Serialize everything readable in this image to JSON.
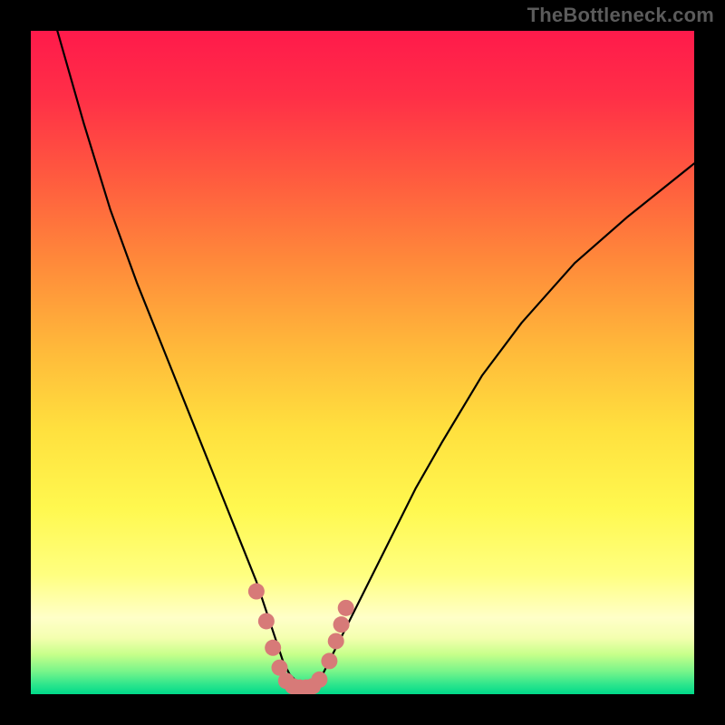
{
  "watermark": "TheBottleneck.com",
  "colors": {
    "black": "#000000",
    "curve": "#000000",
    "dot": "#d77a78",
    "grad_top": "#ff1a4b",
    "grad_mid1": "#ff7a3a",
    "grad_mid2": "#ffd23a",
    "grad_mid3": "#ffff66",
    "grad_pale": "#ffffc0",
    "grad_green1": "#9cff7a",
    "grad_green2": "#30e87a",
    "grad_green3": "#00d98a"
  },
  "chart_data": {
    "type": "line",
    "title": "",
    "xlabel": "",
    "ylabel": "",
    "xlim": [
      0,
      100
    ],
    "ylim": [
      0,
      100
    ],
    "curve": {
      "x": [
        0,
        4,
        8,
        12,
        16,
        20,
        24,
        28,
        30,
        32,
        34,
        35,
        36,
        37,
        38,
        39,
        40,
        41,
        42,
        43,
        44,
        45,
        47,
        50,
        54,
        58,
        62,
        68,
        74,
        82,
        90,
        100
      ],
      "y": [
        118,
        100,
        86,
        73,
        62,
        52,
        42,
        32,
        27,
        22,
        17,
        14,
        11,
        8,
        5,
        3,
        2,
        1,
        1,
        1.5,
        3,
        5,
        9,
        15,
        23,
        31,
        38,
        48,
        56,
        65,
        72,
        80
      ]
    },
    "dots": [
      {
        "x": 34.0,
        "y": 15.5
      },
      {
        "x": 35.5,
        "y": 11.0
      },
      {
        "x": 36.5,
        "y": 7.0
      },
      {
        "x": 37.5,
        "y": 4.0
      },
      {
        "x": 38.5,
        "y": 2.0
      },
      {
        "x": 39.5,
        "y": 1.2
      },
      {
        "x": 40.5,
        "y": 1.0
      },
      {
        "x": 41.5,
        "y": 1.0
      },
      {
        "x": 42.5,
        "y": 1.2
      },
      {
        "x": 43.5,
        "y": 2.2
      },
      {
        "x": 45.0,
        "y": 5.0
      },
      {
        "x": 46.0,
        "y": 8.0
      },
      {
        "x": 46.8,
        "y": 10.5
      },
      {
        "x": 47.5,
        "y": 13.0
      }
    ],
    "dot_radius_px": 9
  }
}
